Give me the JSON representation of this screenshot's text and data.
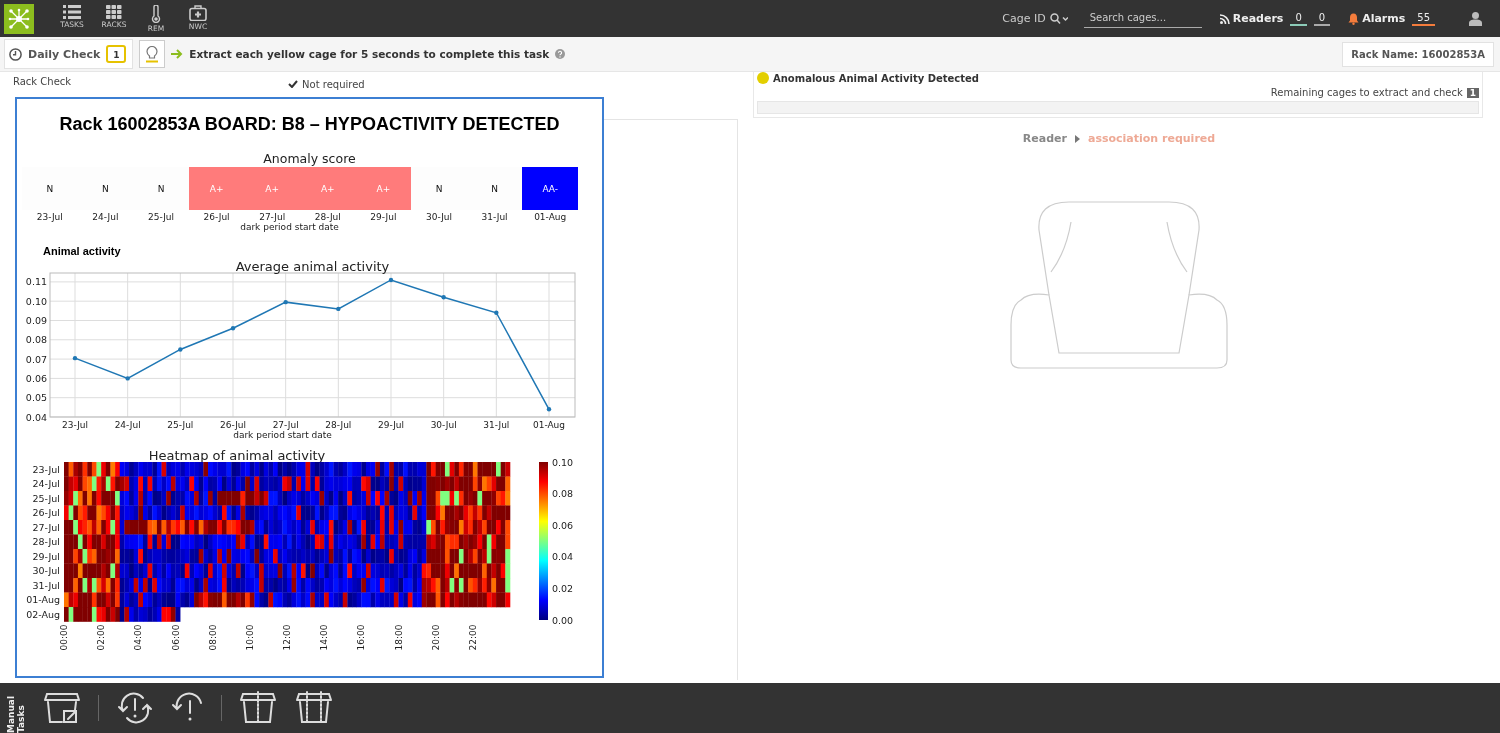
{
  "nav": {
    "items": [
      {
        "label": "TASKS",
        "kind": "tasks"
      },
      {
        "label": "RACKS",
        "kind": "racks"
      },
      {
        "label": "REM",
        "kind": "rem"
      },
      {
        "label": "NWC",
        "kind": "nwc"
      }
    ],
    "cage_id_label": "Cage ID",
    "search": {
      "placeholder": "Search cages..."
    },
    "readers": {
      "label": "Readers",
      "counts": [
        "0",
        "0"
      ]
    },
    "alarms": {
      "label": "Alarms",
      "count": "55"
    }
  },
  "task_bar": {
    "task_button": "Daily Check",
    "calendar_day": "1",
    "instruction": "Extract each yellow cage for 5 seconds to complete this task",
    "rack_name": "Rack Name: 16002853A"
  },
  "rack_check": {
    "label": "Rack Check",
    "status": "Not required"
  },
  "alert": {
    "title": "Anomalous Animal Activity Detected",
    "color": "#e3cf00",
    "remaining_label": "Remaining cages to extract and check",
    "remaining_count": "1",
    "progress": {
      "level": 0
    }
  },
  "reader": {
    "label": "Reader",
    "status": "association required"
  },
  "report": {
    "title": "Rack 16002853A BOARD: B8 – HYPOACTIVITY DETECTED",
    "anomaly": {
      "title": "Anomaly score",
      "xlabel": "dark period start date",
      "cells": [
        {
          "score": "N",
          "date": "23-Jul",
          "color": "#fdfdfd"
        },
        {
          "score": "N",
          "date": "24-Jul",
          "color": "#fdfdfd"
        },
        {
          "score": "N",
          "date": "25-Jul",
          "color": "#fdfdfd"
        },
        {
          "score": "A+",
          "date": "26-Jul",
          "color": "#ff7b7b"
        },
        {
          "score": "A+",
          "date": "27-Jul",
          "color": "#ff7b7b"
        },
        {
          "score": "A+",
          "date": "28-Jul",
          "color": "#ff7b7b"
        },
        {
          "score": "A+",
          "date": "29-Jul",
          "color": "#ff7b7b"
        },
        {
          "score": "N",
          "date": "30-Jul",
          "color": "#fdfdfd"
        },
        {
          "score": "N",
          "date": "31-Jul",
          "color": "#fdfdfd"
        },
        {
          "score": "AA-",
          "date": "01-Aug",
          "color": "#0000ff"
        }
      ]
    },
    "activity_label": "Animal activity",
    "chart_data": {
      "type": "line",
      "title": "Average animal activity",
      "xlabel": "dark period start date",
      "categories": [
        "23-Jul",
        "24-Jul",
        "25-Jul",
        "26-Jul",
        "27-Jul",
        "28-Jul",
        "29-Jul",
        "30-Jul",
        "31-Jul",
        "01-Aug"
      ],
      "series": [
        {
          "color": "#1f77b4",
          "values": [
            0.0705,
            0.06,
            0.075,
            0.086,
            0.0995,
            0.096,
            0.111,
            0.102,
            0.094,
            0.044
          ]
        }
      ],
      "ylim": [
        0.04,
        0.1146
      ],
      "yticks": [
        0.04,
        0.05,
        0.06,
        0.07,
        0.08,
        0.09,
        {
          "value": 0.1,
          "label": "0.10"
        },
        0.11
      ],
      "grid": true
    },
    "heatmap": {
      "title": "Heatmap of animal activity",
      "rows": [
        "23-Jul",
        "24-Jul",
        "25-Jul",
        "26-Jul",
        "27-Jul",
        "28-Jul",
        "29-Jul",
        "30-Jul",
        "31-Jul",
        "01-Aug",
        "02-Aug"
      ],
      "times": [
        "00:00",
        "02:00",
        "04:00",
        "06:00",
        "08:00",
        "10:00",
        "12:00",
        "14:00",
        "16:00",
        "18:00",
        "20:00",
        "22:00"
      ],
      "colorbar_ticks": [
        "0.10",
        "0.08",
        "0.06",
        "0.04",
        "0.02",
        "0.00"
      ]
    }
  },
  "footer": {
    "label": "Manual Tasks",
    "tools": [
      {
        "kind": "cage-edit"
      },
      {
        "kind": "divider"
      },
      {
        "kind": "refresh-alert"
      },
      {
        "kind": "undo-alert"
      },
      {
        "kind": "divider"
      },
      {
        "kind": "cage-split"
      },
      {
        "kind": "cage-split-double"
      }
    ]
  }
}
